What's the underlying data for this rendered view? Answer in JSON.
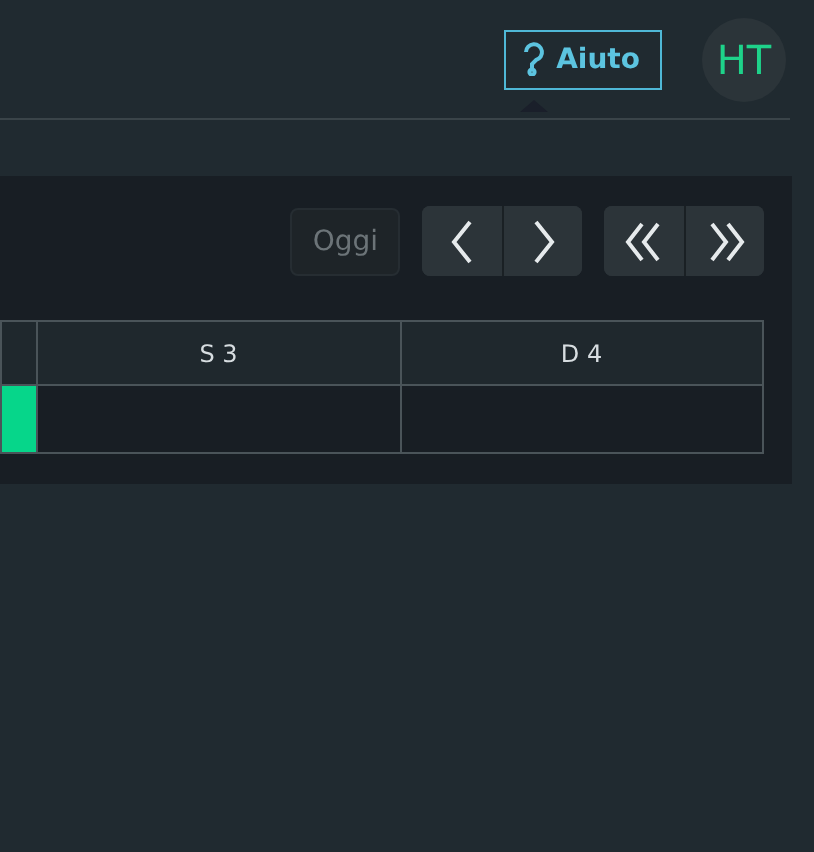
{
  "header": {
    "help_button": {
      "label": "Aiuto"
    },
    "avatar": {
      "initials": "HT"
    }
  },
  "toolbar": {
    "today_button": {
      "label": "Oggi",
      "disabled": true
    }
  },
  "table": {
    "columns": [
      {},
      {
        "label": "S 3"
      },
      {
        "label": "D 4"
      }
    ],
    "rows": [
      {
        "cells": [
          {
            "kind": "event"
          },
          {
            "kind": "empty"
          },
          {
            "kind": "empty"
          }
        ]
      }
    ]
  }
}
